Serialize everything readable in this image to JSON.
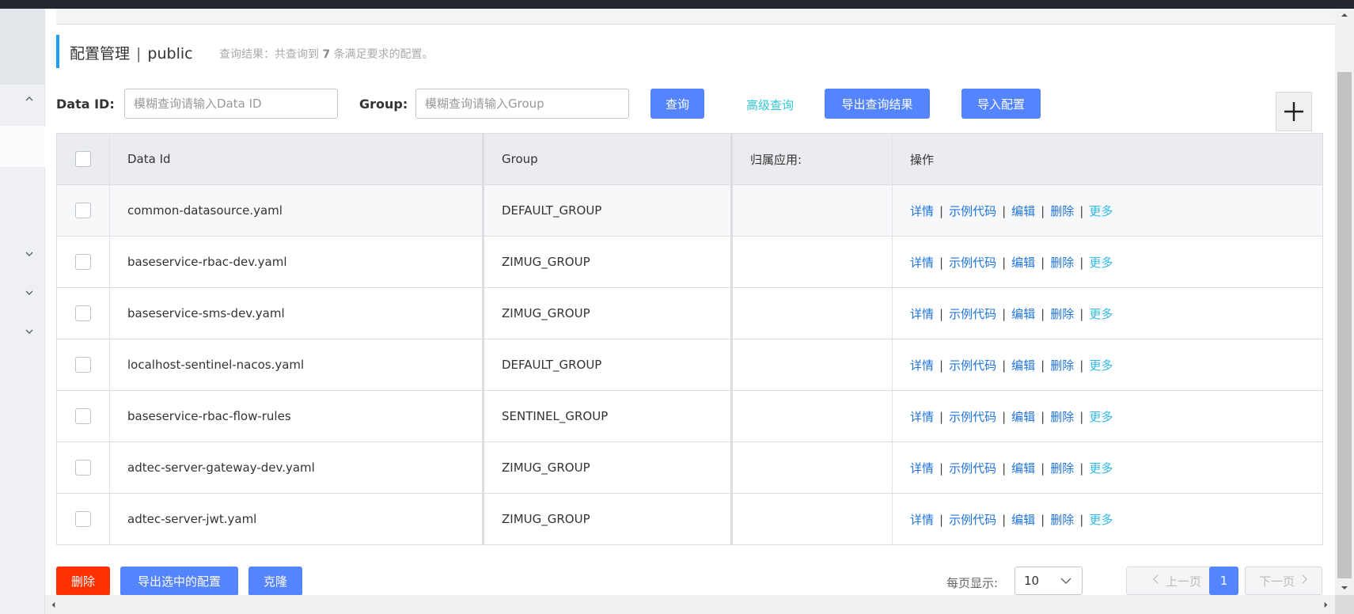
{
  "header": {
    "title": "配置管理",
    "separator": "|",
    "namespace": "public",
    "result_prefix": "查询结果：共查询到",
    "result_count": "7",
    "result_suffix": "条满足要求的配置。"
  },
  "search": {
    "data_id_label": "Data ID:",
    "data_id_placeholder": "模糊查询请输入Data ID",
    "data_id_value": "",
    "group_label": "Group:",
    "group_placeholder": "模糊查询请输入Group",
    "group_value": "",
    "query_button": "查询",
    "advanced_query": "高级查询",
    "export_results_button": "导出查询结果",
    "import_button": "导入配置",
    "add_icon": "plus-icon"
  },
  "table": {
    "columns": [
      "Data Id",
      "Group",
      "归属应用:",
      "操作"
    ],
    "rows": [
      {
        "data_id": "common-datasource.yaml",
        "group": "DEFAULT_GROUP",
        "app": ""
      },
      {
        "data_id": "baseservice-rbac-dev.yaml",
        "group": "ZIMUG_GROUP",
        "app": ""
      },
      {
        "data_id": "baseservice-sms-dev.yaml",
        "group": "ZIMUG_GROUP",
        "app": ""
      },
      {
        "data_id": "localhost-sentinel-nacos.yaml",
        "group": "DEFAULT_GROUP",
        "app": ""
      },
      {
        "data_id": "baseservice-rbac-flow-rules",
        "group": "SENTINEL_GROUP",
        "app": ""
      },
      {
        "data_id": "adtec-server-gateway-dev.yaml",
        "group": "ZIMUG_GROUP",
        "app": ""
      },
      {
        "data_id": "adtec-server-jwt.yaml",
        "group": "ZIMUG_GROUP",
        "app": ""
      }
    ],
    "actions": {
      "detail": "详情",
      "sample_code": "示例代码",
      "edit": "编辑",
      "delete": "删除",
      "more": "更多",
      "separator": "|"
    }
  },
  "footer": {
    "delete_button": "删除",
    "export_selected_button": "导出选中的配置",
    "clone_button": "克隆",
    "page_size_label": "每页显示:",
    "page_size_value": "10",
    "prev_button": "上一页",
    "current_page": "1",
    "next_button": "下一页"
  },
  "colors": {
    "primary": "#5584ff",
    "danger": "#ff3000",
    "link": "#2074de",
    "accent_link": "#31c7d6",
    "title_bar": "#209bfa"
  }
}
